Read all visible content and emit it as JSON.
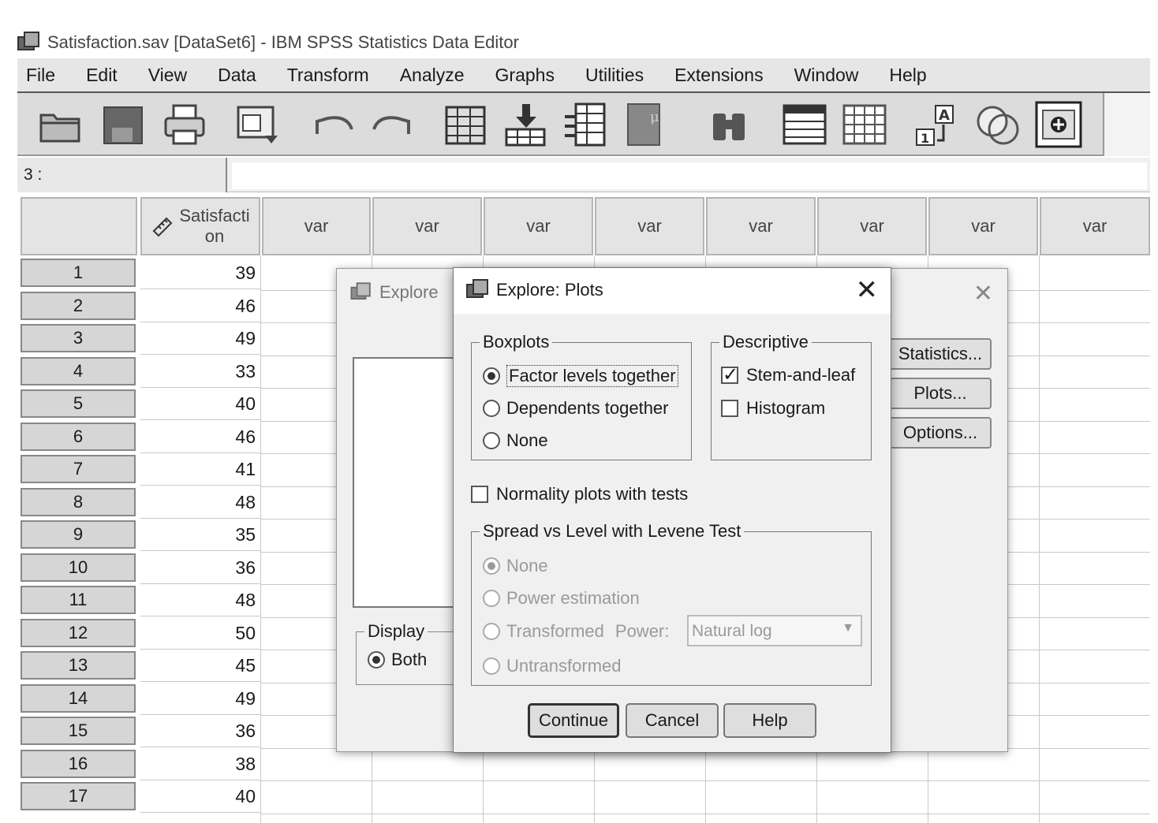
{
  "window": {
    "title": "Satisfaction.sav [DataSet6] - IBM SPSS Statistics Data Editor"
  },
  "menubar": [
    "File",
    "Edit",
    "View",
    "Data",
    "Transform",
    "Analyze",
    "Graphs",
    "Utilities",
    "Extensions",
    "Window",
    "Help"
  ],
  "cellbar": {
    "ref": "3 :",
    "value": ""
  },
  "grid": {
    "columns": [
      "Satisfacti on",
      "var",
      "var",
      "var",
      "var",
      "var",
      "var",
      "var",
      "var"
    ],
    "rows": [
      {
        "n": "1",
        "v": "39"
      },
      {
        "n": "2",
        "v": "46"
      },
      {
        "n": "3",
        "v": "49"
      },
      {
        "n": "4",
        "v": "33"
      },
      {
        "n": "5",
        "v": "40"
      },
      {
        "n": "6",
        "v": "46"
      },
      {
        "n": "7",
        "v": "41"
      },
      {
        "n": "8",
        "v": "48"
      },
      {
        "n": "9",
        "v": "35"
      },
      {
        "n": "10",
        "v": "36"
      },
      {
        "n": "11",
        "v": "48"
      },
      {
        "n": "12",
        "v": "50"
      },
      {
        "n": "13",
        "v": "45"
      },
      {
        "n": "14",
        "v": "49"
      },
      {
        "n": "15",
        "v": "36"
      },
      {
        "n": "16",
        "v": "38"
      },
      {
        "n": "17",
        "v": "40"
      }
    ]
  },
  "explore": {
    "title": "Explore",
    "buttons": {
      "statistics": "Statistics...",
      "plots": "Plots...",
      "options": "Options..."
    },
    "display": {
      "legend": "Display",
      "both": "Both"
    }
  },
  "plots": {
    "title": "Explore: Plots",
    "boxplots": {
      "legend": "Boxplots",
      "factor_levels": "Factor levels together",
      "dependents": "Dependents together",
      "none": "None"
    },
    "descriptive": {
      "legend": "Descriptive",
      "stem_leaf": "Stem-and-leaf",
      "histogram": "Histogram"
    },
    "normality": "Normality plots with tests",
    "spread": {
      "legend": "Spread vs Level with Levene Test",
      "none": "None",
      "power_estimation": "Power estimation",
      "transformed": "Transformed",
      "power_label": "Power:",
      "power_value": "Natural log",
      "untransformed": "Untransformed"
    },
    "buttons": {
      "continue": "Continue",
      "cancel": "Cancel",
      "help": "Help"
    }
  }
}
